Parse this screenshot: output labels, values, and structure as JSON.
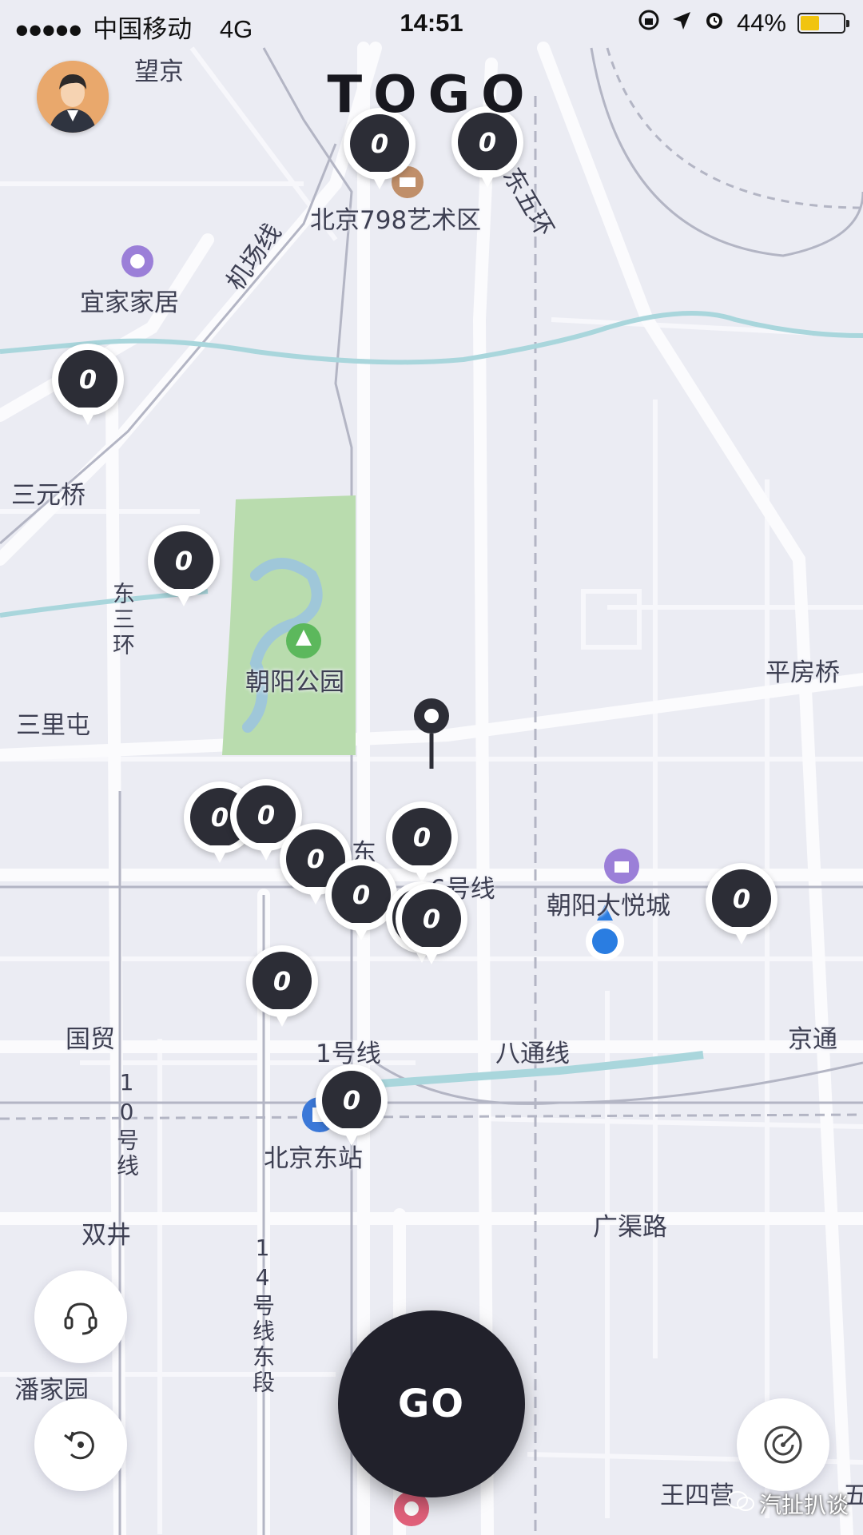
{
  "status_bar": {
    "signal": "●●●●●",
    "carrier": "中国移动",
    "network": "4G",
    "time": "14:51",
    "battery_percent": "44%",
    "battery_level": 0.44
  },
  "header": {
    "logo": "TOGO"
  },
  "map": {
    "labels": {
      "wangjing": "望京",
      "798": "北京798艺术区",
      "dongwuhuan": "东五环",
      "jichangxian": "机场线",
      "yijia": "宜家家居",
      "sanyuanqiao": "三元桥",
      "dongsanhuan": "东三环",
      "chaoyang_park": "朝阳公园",
      "sanlitun": "三里屯",
      "pingfangqiao": "平房桥",
      "line6": "6号线",
      "dong": "东",
      "joycity": "朝阳大悦城",
      "guomao": "国贸",
      "line1": "1号线",
      "batong": "八通线",
      "jingtong": "京通",
      "line10": "10号线",
      "bj_east_station": "北京东站",
      "shuangjing": "双井",
      "guangqulu": "广渠路",
      "line14": "14号线东段",
      "panjiayuan": "潘家园",
      "wangsiying": "王四营",
      "wu": "五"
    },
    "markers": [
      "0",
      "0",
      "0",
      "0",
      "0",
      "0",
      "0",
      "0",
      "0",
      "0",
      "0",
      "0",
      "0"
    ]
  },
  "controls": {
    "go_label": "GO"
  },
  "watermark": {
    "text": "汽扯扒谈"
  },
  "colors": {
    "map_bg": "#ebecf3",
    "park": "#b9dcae",
    "river": "#a9d6dc",
    "marker": "#2c2d36",
    "go_button": "#21212b",
    "location_dot": "#2a7de1"
  }
}
